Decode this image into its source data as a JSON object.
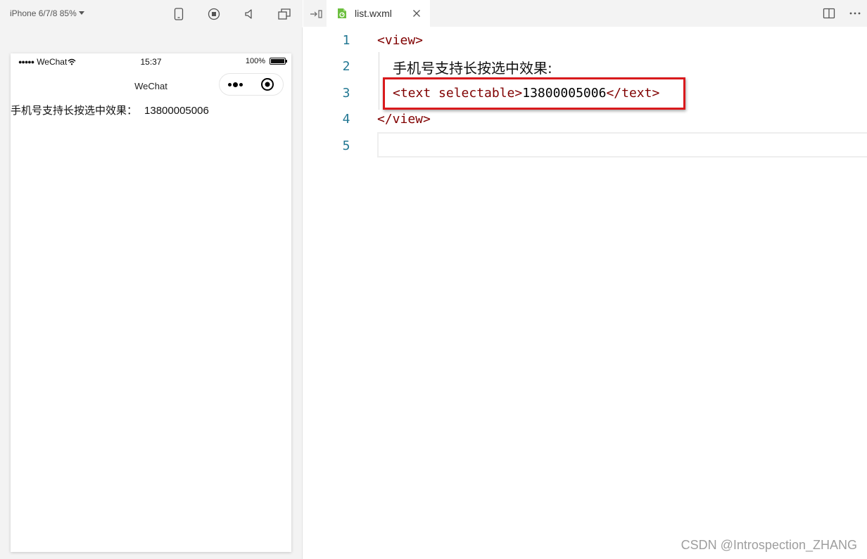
{
  "simulator": {
    "device_label": "iPhone 6/7/8 85%",
    "status_bar": {
      "carrier": "WeChat",
      "time": "15:37",
      "battery": "100%"
    },
    "nav_title": "WeChat",
    "page_text": "手机号支持长按选中效果：",
    "page_number": "13800005006"
  },
  "editor": {
    "tab_label": "list.wxml",
    "line_numbers": [
      "1",
      "2",
      "3",
      "4",
      "5"
    ],
    "lines": {
      "l1": "<view>",
      "l2": "手机号支持长按选中效果:",
      "l3_open": "<text selectable>",
      "l3_text": "13800005006",
      "l3_close": "</text>",
      "l4": "</view>"
    }
  },
  "watermark": "CSDN @Introspection_ZHANG",
  "colors": {
    "line_number": "#237893",
    "tag": "#800000",
    "highlight_box": "#d9191c",
    "file_icon": "#6cbf3f"
  },
  "icons": [
    "phone-icon",
    "record-icon",
    "sound-icon",
    "window-icon",
    "split-toggle-icon",
    "file-icon",
    "close-icon",
    "split-editor-icon",
    "more-icon",
    "wifi-icon",
    "battery-icon",
    "capsule-menu-icon",
    "capsule-home-icon"
  ]
}
